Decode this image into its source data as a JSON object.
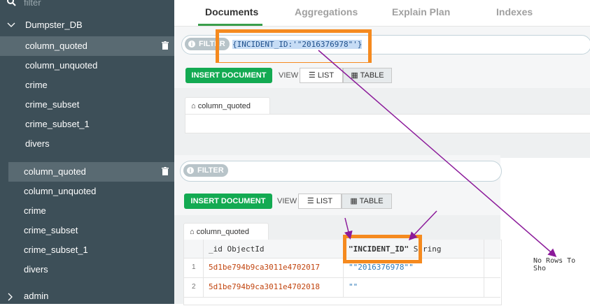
{
  "sidebar": {
    "filter_placeholder": "filter",
    "database": "Dumpster_DB",
    "collections_top": [
      {
        "label": "column_quoted",
        "active": true
      },
      {
        "label": "column_unquoted"
      },
      {
        "label": "crime"
      },
      {
        "label": "crime_subset"
      },
      {
        "label": "crime_subset_1"
      },
      {
        "label": "divers"
      }
    ],
    "collections_bottom": [
      {
        "label": "column_quoted",
        "active": true
      },
      {
        "label": "column_unquoted"
      },
      {
        "label": "crime"
      },
      {
        "label": "crime_subset"
      },
      {
        "label": "crime_subset_1"
      },
      {
        "label": "divers"
      }
    ],
    "admin": "admin"
  },
  "tabs": [
    "Documents",
    "Aggregations",
    "Explain Plan",
    "Indexes"
  ],
  "top_panel": {
    "filter_label": "FILTER",
    "filter_query": "{INCIDENT_ID:'\"2016376978\"'}",
    "insert_label": "INSERT DOCUMENT",
    "view_label": "VIEW",
    "list_label": "LIST",
    "table_label": "TABLE",
    "collection_tab": "column_quoted",
    "empty_message": "No Rows To Sho"
  },
  "bottom_panel": {
    "filter_label": "FILTER",
    "insert_label": "INSERT DOCUMENT",
    "view_label": "VIEW",
    "list_label": "LIST",
    "table_label": "TABLE",
    "collection_tab": "column_quoted",
    "columns": [
      {
        "name": "_id",
        "type": "ObjectId"
      },
      {
        "name": "\"INCIDENT_ID\"",
        "type": "String"
      }
    ],
    "rows": [
      {
        "num": "1",
        "id": "5d1be794b9ca3011e4702017",
        "value": "\"\"2016376978\"\""
      },
      {
        "num": "2",
        "id": "5d1be794b9ca3011e4702018",
        "value": "\"\""
      }
    ]
  },
  "colors": {
    "accent": "#13aa52",
    "highlight": "#f58a1f",
    "arrow": "#8b1a9a",
    "sidebar": "#3d4f58"
  }
}
